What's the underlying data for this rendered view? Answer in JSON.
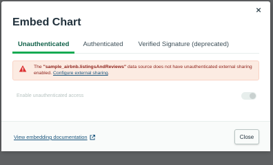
{
  "dialog": {
    "title": "Embed Chart",
    "close_glyph": "×"
  },
  "tabs": [
    {
      "label": "Unauthenticated",
      "active": true
    },
    {
      "label": "Authenticated",
      "active": false
    },
    {
      "label": "Verified Signature (deprecated)",
      "active": false
    }
  ],
  "alert": {
    "icon": "warning-icon",
    "text_prefix": "The ",
    "data_source": "\"sample_airbnb.listingsAndReviews\"",
    "text_suffix": " data source does not have unauthenticated external sharing enabled. ",
    "link_label": "Configure external sharing",
    "link_end": "."
  },
  "toggle": {
    "label": "Enable unauthenticated access",
    "enabled": false
  },
  "footer": {
    "doc_link_label": "View embedding documentation",
    "doc_link_icon": "external-link-icon",
    "close_label": "Close"
  },
  "colors": {
    "accent_green": "#13aa52",
    "alert_bg": "#fcebe2",
    "alert_text": "#8f221b",
    "link": "#1a567e"
  }
}
